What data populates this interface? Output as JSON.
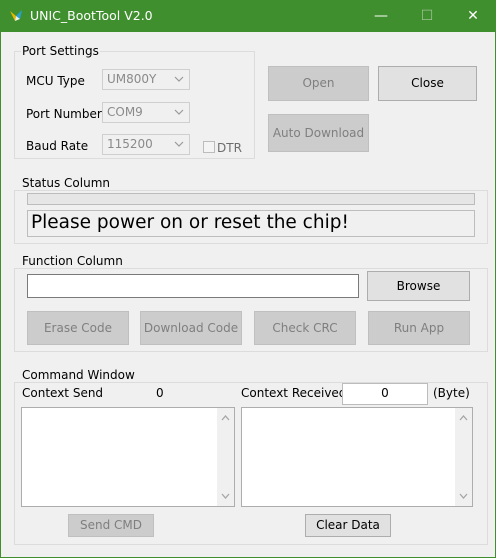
{
  "window": {
    "title": "UNIC_BootTool V2.0",
    "minimize_symbol": "—",
    "maximize_symbol": "☐",
    "close_symbol": "✕"
  },
  "port_settings": {
    "group_title": "Port Settings",
    "mcu_type_label": "MCU Type",
    "mcu_type_value": "UM800Y",
    "port_number_label": "Port Number",
    "port_number_value": "COM9",
    "baud_rate_label": "Baud Rate",
    "baud_rate_value": "115200",
    "dtr_label": "DTR",
    "dtr_checked": false
  },
  "buttons": {
    "open": "Open",
    "close": "Close",
    "auto_download": "Auto Download",
    "browse": "Browse",
    "erase_code": "Erase Code",
    "download_code": "Download Code",
    "check_crc": "Check CRC",
    "run_app": "Run App",
    "send_cmd": "Send CMD",
    "clear_data": "Clear Data"
  },
  "status": {
    "group_title": "Status Column",
    "progress_fraction": 0,
    "message": "Please power on or reset the chip!"
  },
  "function": {
    "group_title": "Function Column",
    "file_path": ""
  },
  "command": {
    "group_title": "Command Window",
    "context_send_label": "Context Send",
    "context_send_count": "0",
    "context_received_label": "Context Received",
    "context_received_count": "0",
    "byte_unit": "(Byte)",
    "send_text": "",
    "received_text": ""
  },
  "colors": {
    "title_bar": "#3f8f2e",
    "client_bg": "#f0f0f0"
  },
  "icons": {
    "app": "unic-logo-icon",
    "combo_arrow": "chevron-down-icon",
    "scroll_up": "scroll-up-arrow-icon",
    "scroll_down": "scroll-down-arrow-icon"
  }
}
